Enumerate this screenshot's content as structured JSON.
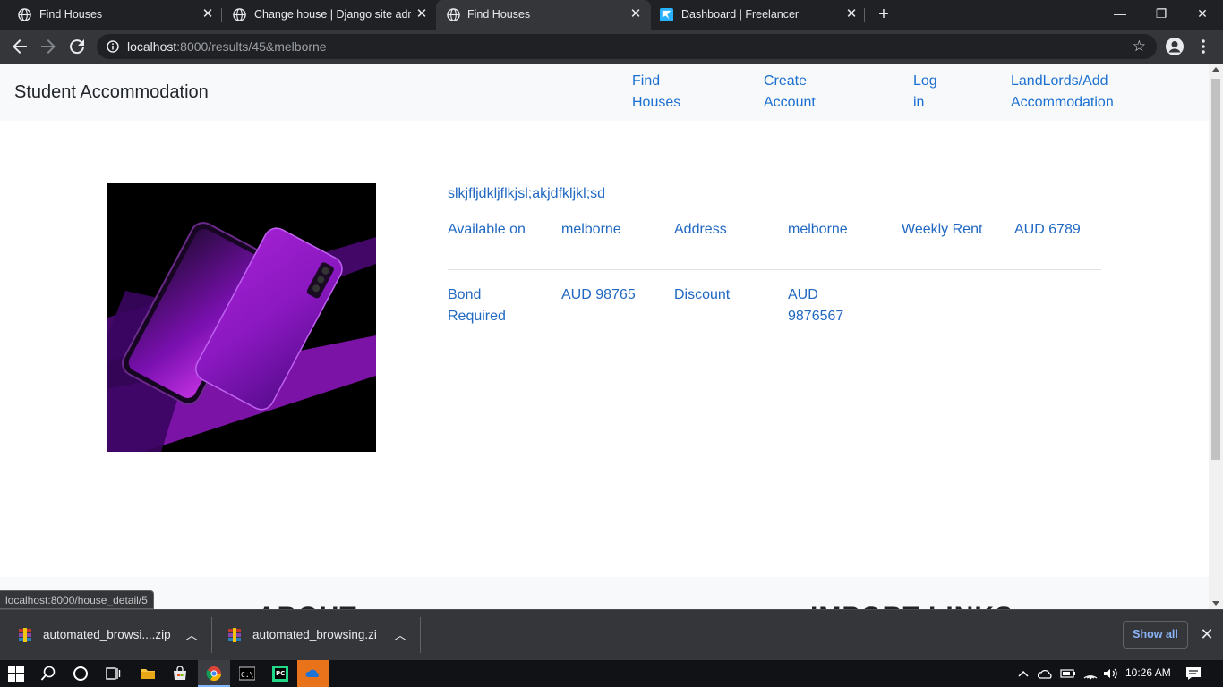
{
  "browser": {
    "tabs": [
      {
        "title": "Find Houses",
        "active": false
      },
      {
        "title": "Change house | Django site adm",
        "active": false
      },
      {
        "title": "Find Houses",
        "active": true
      },
      {
        "title": "Dashboard | Freelancer",
        "active": false
      }
    ],
    "url_host": "localhost",
    "url_rest": ":8000/results/45&melborne",
    "status_url": "localhost:8000/house_detail/5",
    "controls": {
      "minimize": "—",
      "restore": "❐",
      "close": "✕",
      "new_tab": "+"
    }
  },
  "navbar": {
    "brand": "Student Accommodation",
    "links": [
      {
        "line1": "Find",
        "line2": "Houses"
      },
      {
        "line1": "Create",
        "line2": "Account"
      },
      {
        "line1": "Log",
        "line2": "in"
      },
      {
        "line1": "LandLords/Add",
        "line2": "Accommodation"
      }
    ]
  },
  "listing": {
    "title": "slkjfljdkljflkjsl;akjdfkljkl;sd",
    "available_label": "Available on",
    "available_value": "melborne",
    "address_label": "Address",
    "address_value": "melborne",
    "rent_label": "Weekly Rent",
    "rent_value": "AUD 6789",
    "bond_label_1": "Bond",
    "bond_label_2": "Required",
    "bond_value": "AUD 98765",
    "discount_label": "Discount",
    "discount_value_1": "AUD",
    "discount_value_2": "9876567"
  },
  "footer": {
    "heading_left": "ABOUT",
    "heading_right": "IMPORT LINKS"
  },
  "downloads": {
    "items": [
      {
        "name": "automated_browsi....zip"
      },
      {
        "name": "automated_browsing.zi"
      }
    ],
    "show_all": "Show all"
  },
  "taskbar": {
    "time": "10:26 AM"
  },
  "colors": {
    "link": "#2068c2",
    "navbar_bg": "#f8f9fa",
    "chrome_dark": "#202124",
    "chrome_toolbar": "#35363a"
  }
}
